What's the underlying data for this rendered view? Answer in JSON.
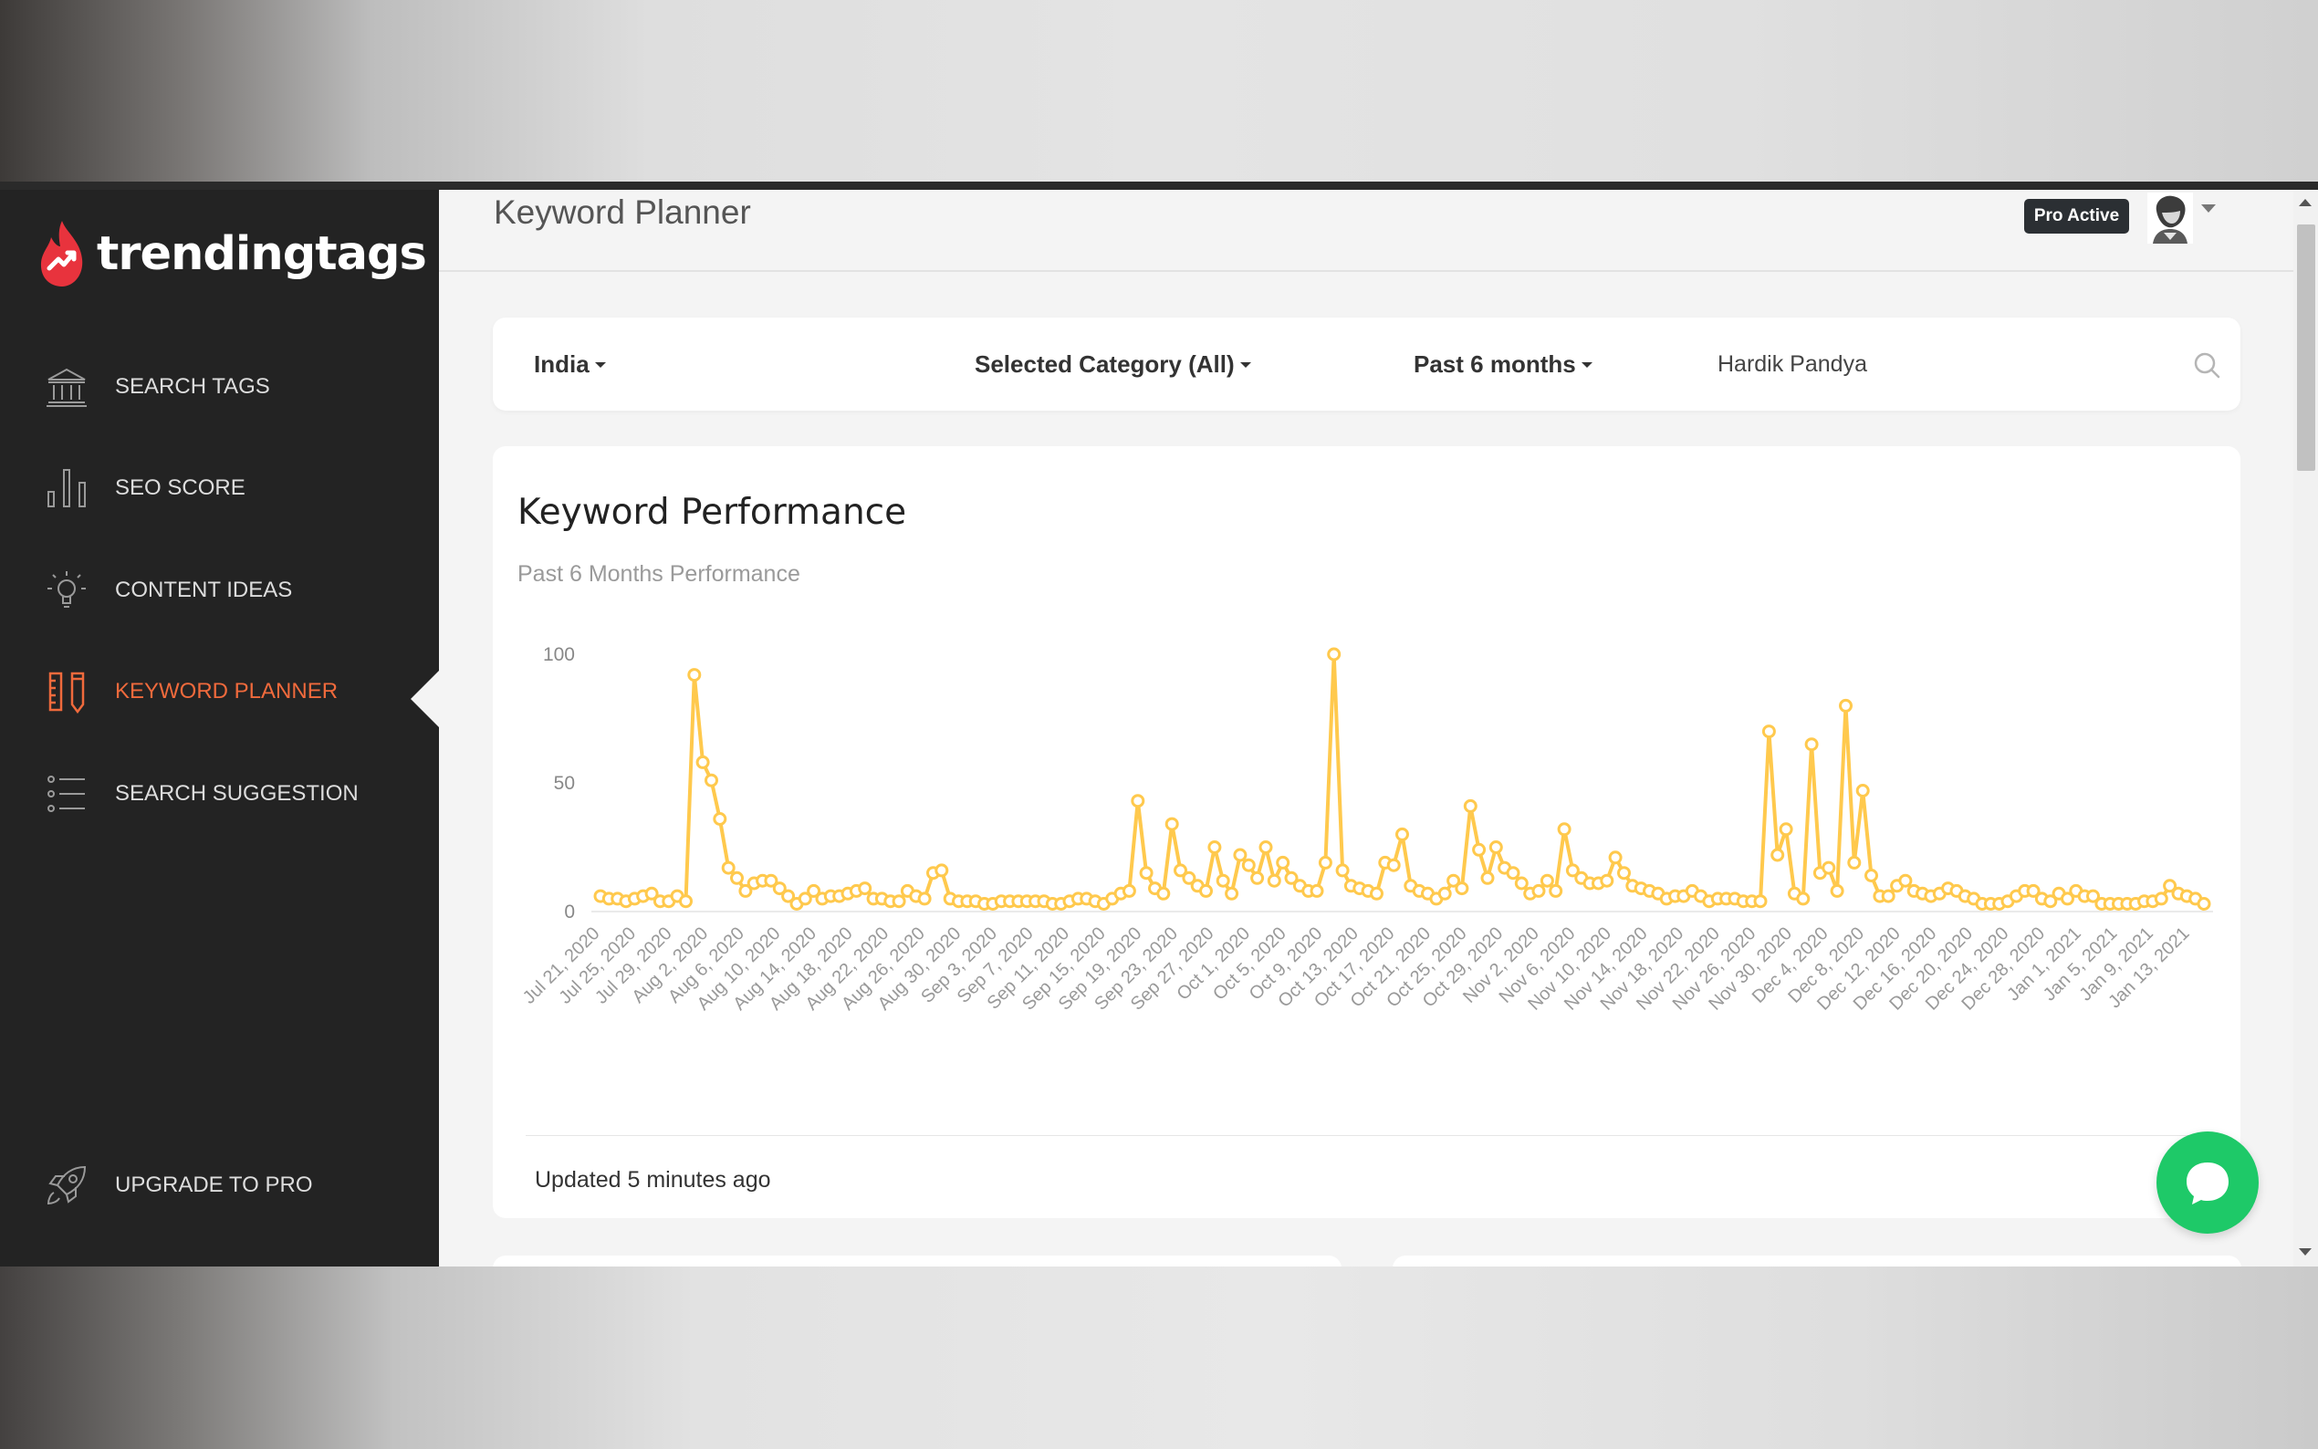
{
  "app": {
    "brand": "trendingtags"
  },
  "sidebar": {
    "items": [
      {
        "label": "SEARCH TAGS",
        "icon": "bank-icon"
      },
      {
        "label": "SEO SCORE",
        "icon": "bar-chart-icon"
      },
      {
        "label": "CONTENT IDEAS",
        "icon": "lightbulb-icon"
      },
      {
        "label": "KEYWORD PLANNER",
        "icon": "ruler-pencil-icon",
        "active": true
      },
      {
        "label": "SEARCH SUGGESTION",
        "icon": "list-icon"
      }
    ],
    "upgrade": {
      "label": "UPGRADE TO PRO",
      "icon": "rocket-icon"
    }
  },
  "header": {
    "title": "Keyword Planner",
    "badge": "Pro Active"
  },
  "filters": {
    "country": "India",
    "category": "Selected Category (All)",
    "period": "Past 6 months",
    "search_value": "Hardik Pandya"
  },
  "card": {
    "title": "Keyword Performance",
    "subtitle": "Past 6 Months Performance",
    "updated": "Updated 5 minutes ago"
  },
  "colors": {
    "sidebar_bg": "#232323",
    "accent": "#f06a3c",
    "line": "#ffc94d",
    "chat": "#1ec968"
  },
  "chart_data": {
    "type": "line",
    "ylim": [
      0,
      100
    ],
    "yticks": [
      0,
      50,
      100
    ],
    "xtick_labels": [
      "Jul 21, 2020",
      "Jul 25, 2020",
      "Jul 29, 2020",
      "Aug 2, 2020",
      "Aug 6, 2020",
      "Aug 10, 2020",
      "Aug 14, 2020",
      "Aug 18, 2020",
      "Aug 22, 2020",
      "Aug 26, 2020",
      "Aug 30, 2020",
      "Sep 3, 2020",
      "Sep 7, 2020",
      "Sep 11, 2020",
      "Sep 15, 2020",
      "Sep 19, 2020",
      "Sep 23, 2020",
      "Sep 27, 2020",
      "Oct 1, 2020",
      "Oct 5, 2020",
      "Oct 9, 2020",
      "Oct 13, 2020",
      "Oct 17, 2020",
      "Oct 21, 2020",
      "Oct 25, 2020",
      "Oct 29, 2020",
      "Nov 2, 2020",
      "Nov 6, 2020",
      "Nov 10, 2020",
      "Nov 14, 2020",
      "Nov 18, 2020",
      "Nov 22, 2020",
      "Nov 26, 2020",
      "Nov 30, 2020",
      "Dec 4, 2020",
      "Dec 8, 2020",
      "Dec 12, 2020",
      "Dec 16, 2020",
      "Dec 20, 2020",
      "Dec 24, 2020",
      "Dec 28, 2020",
      "Jan 1, 2021",
      "Jan 5, 2021",
      "Jan 9, 2021",
      "Jan 13, 2021"
    ],
    "values": [
      6,
      5,
      5,
      4,
      5,
      6,
      7,
      4,
      4,
      6,
      4,
      92,
      58,
      51,
      36,
      17,
      13,
      8,
      11,
      12,
      12,
      9,
      6,
      3,
      5,
      8,
      5,
      6,
      6,
      7,
      8,
      9,
      5,
      5,
      4,
      4,
      8,
      6,
      5,
      15,
      16,
      5,
      4,
      4,
      4,
      3,
      3,
      4,
      4,
      4,
      4,
      4,
      4,
      3,
      3,
      4,
      5,
      5,
      4,
      3,
      5,
      7,
      8,
      43,
      15,
      9,
      7,
      34,
      16,
      13,
      10,
      8,
      25,
      12,
      7,
      22,
      18,
      13,
      25,
      12,
      19,
      13,
      10,
      8,
      8,
      19,
      100,
      16,
      10,
      9,
      8,
      7,
      19,
      18,
      30,
      10,
      8,
      7,
      5,
      7,
      12,
      9,
      41,
      24,
      13,
      25,
      17,
      15,
      11,
      7,
      8,
      12,
      8,
      32,
      16,
      13,
      11,
      11,
      12,
      21,
      15,
      10,
      9,
      8,
      7,
      5,
      6,
      6,
      8,
      6,
      4,
      5,
      5,
      5,
      4,
      4,
      4,
      70,
      22,
      32,
      7,
      5,
      65,
      15,
      17,
      8,
      80,
      19,
      47,
      14,
      6,
      6,
      10,
      12,
      8,
      7,
      6,
      7,
      9,
      8,
      6,
      5,
      3,
      3,
      3,
      4,
      6,
      8,
      8,
      5,
      4,
      7,
      5,
      8,
      6,
      6,
      3,
      3,
      3,
      3,
      3,
      4,
      4,
      5,
      10,
      7,
      6,
      5,
      3
    ]
  }
}
